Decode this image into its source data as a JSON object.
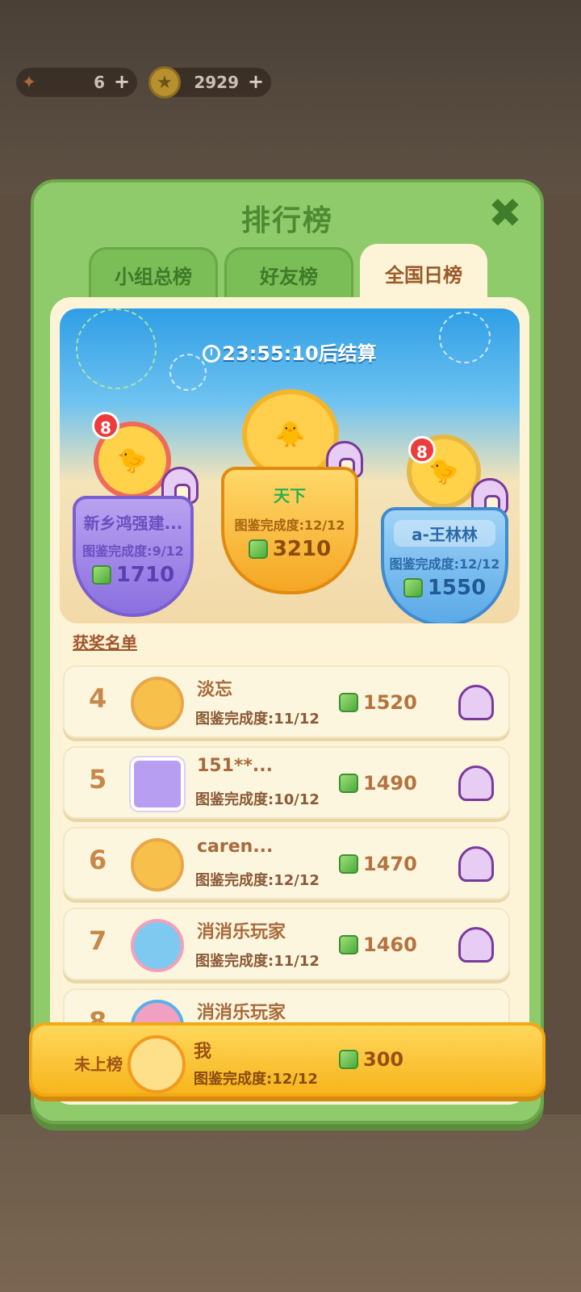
{
  "currency": {
    "firecrackers": "6",
    "coins": "2929"
  },
  "panel": {
    "title": "排行榜",
    "tabs": [
      "小组总榜",
      "好友榜",
      "全国日榜"
    ],
    "active_tab": "全国日榜"
  },
  "podium": {
    "countdown": "23:55:10后结算",
    "first": {
      "name": "天下",
      "completion": "图鉴完成度:12/12",
      "score": "3210"
    },
    "second": {
      "name": "新乡鸿强建...",
      "completion": "图鉴完成度:9/12",
      "score": "1710",
      "badge": "8"
    },
    "third": {
      "name": "a-王林林",
      "completion": "图鉴完成度:12/12",
      "score": "1550",
      "badge": "8"
    }
  },
  "awards_label": "获奖名单",
  "rows": [
    {
      "rank": "4",
      "name": "淡忘",
      "completion": "图鉴完成度:11/12",
      "score": "1520"
    },
    {
      "rank": "5",
      "name": "151**...",
      "completion": "图鉴完成度:10/12",
      "score": "1490"
    },
    {
      "rank": "6",
      "name": "caren...",
      "completion": "图鉴完成度:12/12",
      "score": "1470"
    },
    {
      "rank": "7",
      "name": "消消乐玩家",
      "completion": "图鉴完成度:11/12",
      "score": "1460"
    },
    {
      "rank": "8",
      "name": "消消乐玩家",
      "completion": "",
      "score": ""
    }
  ],
  "me": {
    "status": "未上榜",
    "name": "我",
    "completion": "图鉴完成度:12/12",
    "score": "300"
  },
  "colors": {
    "panel_green": "#8fcb6a",
    "gold": "#f6b51d"
  }
}
